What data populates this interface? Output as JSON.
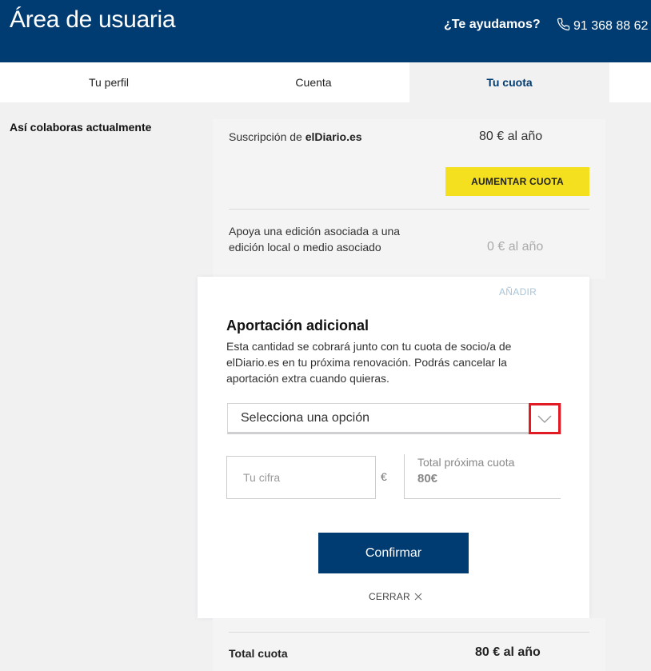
{
  "header": {
    "title": "Área de usuaria",
    "help_label": "¿Te ayudamos?",
    "phone": "91 368 88 62",
    "bg_color": "#003b71"
  },
  "tabs": [
    {
      "label": "Tu perfil",
      "active": false
    },
    {
      "label": "Cuenta",
      "active": false
    },
    {
      "label": "Tu cuota",
      "active": true
    }
  ],
  "section_title": "Así colaboras actualmente",
  "subscription": {
    "label_prefix": "Suscripción de ",
    "label_brand": "elDiario.es",
    "price": "80 € al año",
    "increase_button": "AUMENTAR CUOTA",
    "accent_color": "#f4e01e"
  },
  "local_edition": {
    "label": "Apoya una edición asociada a una edición local o medio asociado",
    "price": "0 € al año",
    "add_label": "AÑADIR"
  },
  "modal": {
    "title": "Aportación adicional",
    "description": "Esta cantidad se cobrará junto con tu cuota de socio/a de elDiario.es en tu próxima renovación. Podrás cancelar la aportación extra cuando quieras.",
    "select_value": "Selecciona una opción",
    "amount_placeholder": "Tu cifra",
    "currency": "€",
    "next_total_label": "Total próxima cuota",
    "next_total_value": "80€",
    "confirm_button": "Confirmar",
    "close_label": "CERRAR"
  },
  "total": {
    "label": "Total cuota",
    "value": "80 € al año"
  },
  "icons": {
    "phone": "phone-icon",
    "chevron": "chevron-down-icon",
    "close": "close-icon"
  }
}
